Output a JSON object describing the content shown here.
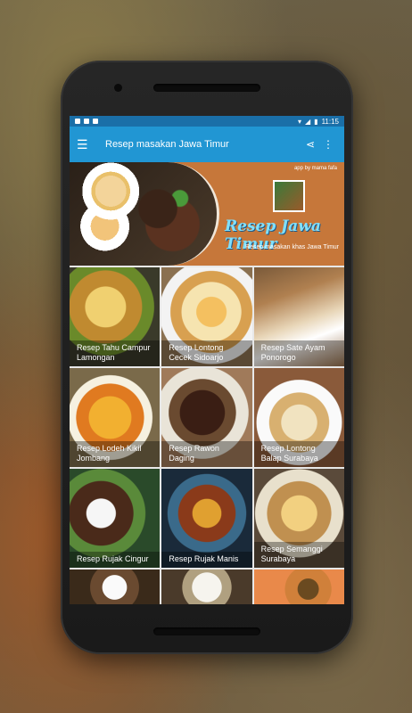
{
  "status": {
    "time": "11:15"
  },
  "appbar": {
    "title": "Resep masakan Jawa Timur"
  },
  "banner": {
    "by": "app by mama fafa",
    "title": "Resep Jawa Timur",
    "subtitle": "Resep masakan khas Jawa Timur"
  },
  "recipes": [
    {
      "label": "Resep Tahu Campur Lamongan"
    },
    {
      "label": "Resep Lontong Cecek Sidoarjo"
    },
    {
      "label": "Resep Sate Ayam Ponorogo"
    },
    {
      "label": "Resep Lodeh Kikil Jombang"
    },
    {
      "label": "Resep Rawon Daging"
    },
    {
      "label": "Resep Lontong Balap Surabaya"
    },
    {
      "label": "Resep Rujak Cingur"
    },
    {
      "label": "Resep Rujak Manis"
    },
    {
      "label": "Resep Semanggi Surabaya"
    }
  ]
}
